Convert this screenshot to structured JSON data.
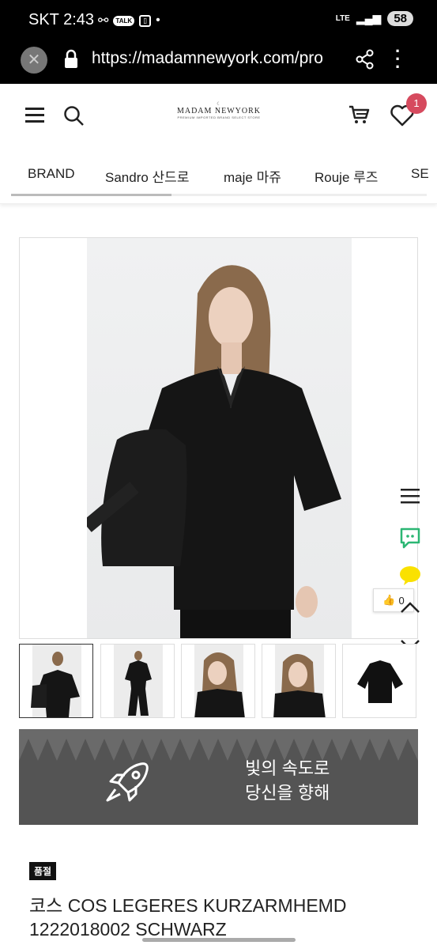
{
  "status_bar": {
    "time": "2:43",
    "carrier": "SKT",
    "network": "LTE",
    "battery": "58"
  },
  "browser": {
    "url": "https://madamnewyork.com/pro"
  },
  "header": {
    "logo_text": "MADAM NEWYORK",
    "logo_sub": "PREMIUM IMPORTED BRAND SELECT STORE",
    "wishlist_count": "1"
  },
  "category_nav": {
    "items": [
      "BRAND",
      "Sandro 산드로",
      "maje 마쥬",
      "Rouje 루즈",
      "SE"
    ]
  },
  "floating": {
    "like_count": "0"
  },
  "banner": {
    "line1": "빛의 속도로",
    "line2": "당신을 향해"
  },
  "product": {
    "badge": "품절",
    "title_line1": "코스 COS LEGERES KURZARMHEMD",
    "title_line2": "1222018002 SCHWARZ"
  },
  "colors": {
    "badge": "#d64a5e",
    "banner_bg": "#545454"
  }
}
